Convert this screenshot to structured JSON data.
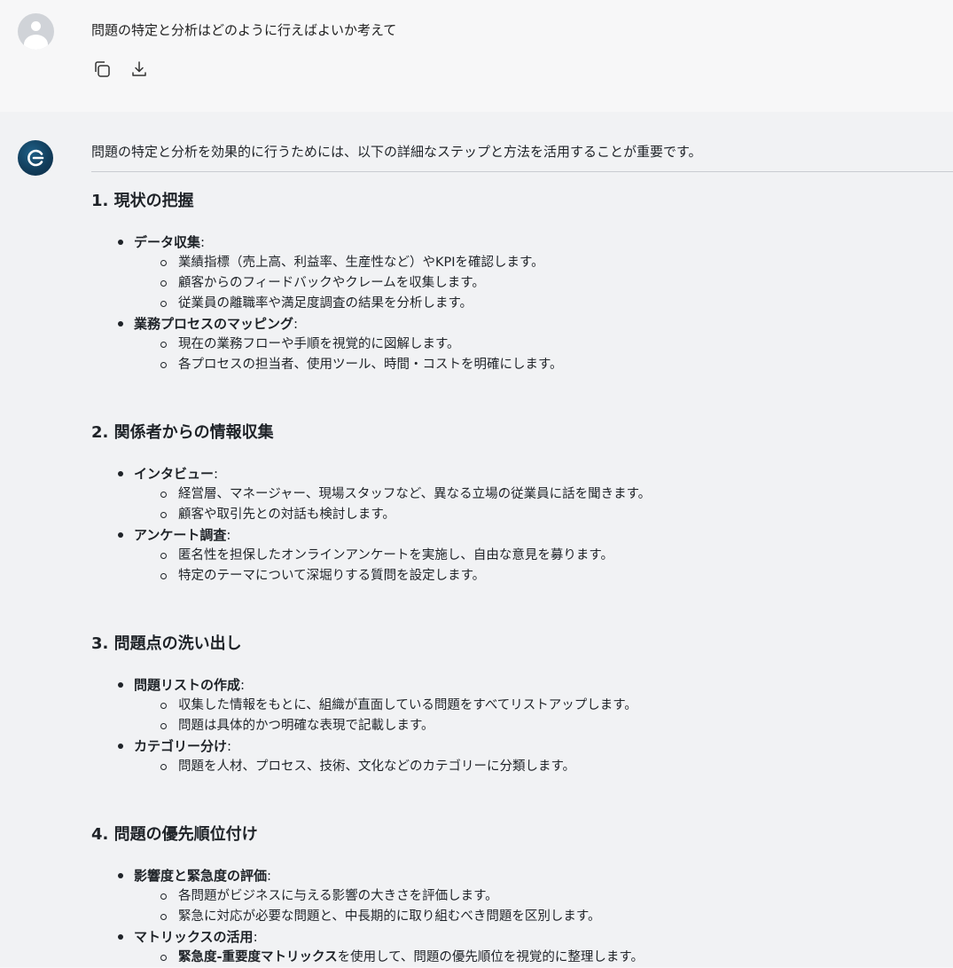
{
  "user_message": {
    "text": "問題の特定と分析はどのように行えばよいか考えて",
    "actions": [
      {
        "icon": "copy-icon"
      },
      {
        "icon": "download-icon"
      }
    ]
  },
  "assistant": {
    "intro": "問題の特定と分析を効果的に行うためには、以下の詳細なステップと方法を活用することが重要です。",
    "sections": [
      {
        "heading": "1. 現状の把握",
        "items": [
          {
            "title": "データ収集",
            "colon": ":",
            "subs": [
              "業績指標（売上高、利益率、生産性など）やKPIを確認します。",
              "顧客からのフィードバックやクレームを収集します。",
              "従業員の離職率や満足度調査の結果を分析します。"
            ]
          },
          {
            "title": "業務プロセスのマッピング",
            "colon": ":",
            "subs": [
              "現在の業務フローや手順を視覚的に図解します。",
              "各プロセスの担当者、使用ツール、時間・コストを明確にします。"
            ]
          }
        ]
      },
      {
        "heading": "2. 関係者からの情報収集",
        "items": [
          {
            "title": "インタビュー",
            "colon": ":",
            "subs": [
              "経営層、マネージャー、現場スタッフなど、異なる立場の従業員に話を聞きます。",
              "顧客や取引先との対話も検討します。"
            ]
          },
          {
            "title": "アンケート調査",
            "colon": ":",
            "subs": [
              "匿名性を担保したオンラインアンケートを実施し、自由な意見を募ります。",
              "特定のテーマについて深堀りする質問を設定します。"
            ]
          }
        ]
      },
      {
        "heading": "3. 問題点の洗い出し",
        "items": [
          {
            "title": "問題リストの作成",
            "colon": ":",
            "subs": [
              "収集した情報をもとに、組織が直面している問題をすべてリストアップします。",
              "問題は具体的かつ明確な表現で記載します。"
            ]
          },
          {
            "title": "カテゴリー分け",
            "colon": ":",
            "subs": [
              "問題を人材、プロセス、技術、文化などのカテゴリーに分類します。"
            ]
          }
        ]
      },
      {
        "heading": "4. 問題の優先順位付け",
        "items": [
          {
            "title": "影響度と緊急度の評価",
            "colon": ":",
            "subs": [
              "各問題がビジネスに与える影響の大きさを評価します。",
              "緊急に対応が必要な問題と、中長期的に取り組むべき問題を区別します。"
            ]
          },
          {
            "title": "マトリックスの活用",
            "colon": ":",
            "last_sub": {
              "bold": "緊急度-重要度マトリックス",
              "rest": "を使用して、問題の優先順位を視覚的に整理します。"
            }
          }
        ]
      }
    ]
  }
}
